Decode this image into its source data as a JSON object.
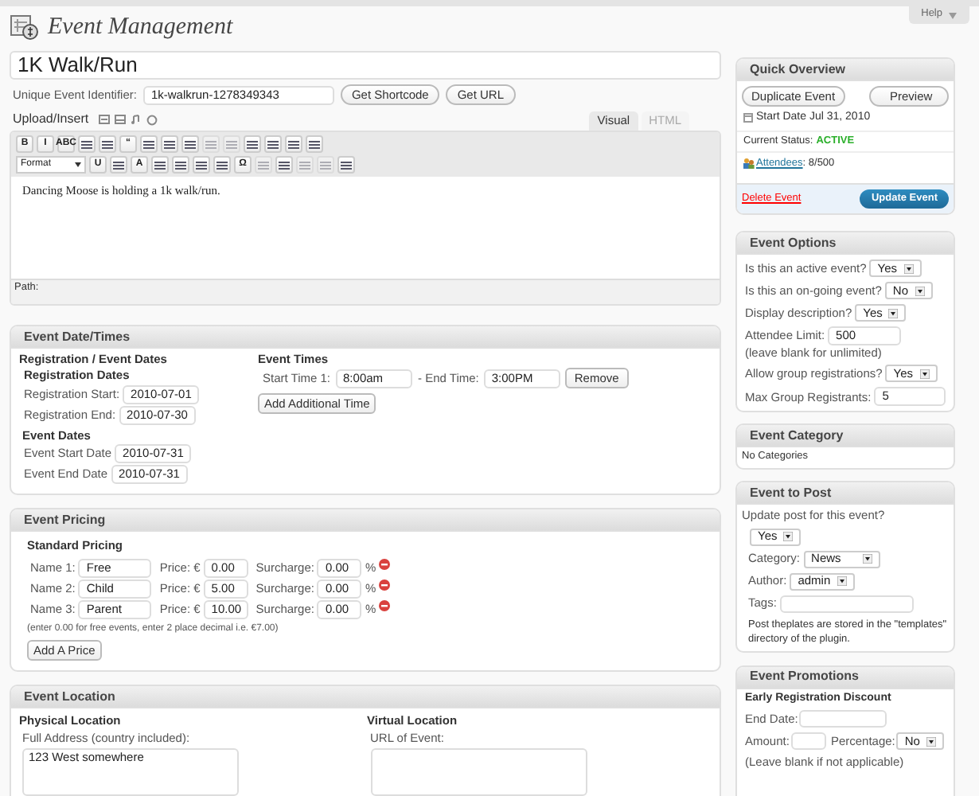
{
  "header": {
    "title": "Event Management",
    "help": "Help"
  },
  "event": {
    "title": "1K Walk/Run",
    "identifier_label": "Unique Event Identifier:",
    "identifier": "1k-walkrun-1278349343",
    "buttons": [
      "Get Shortcode",
      "Get URL"
    ],
    "upload_label": "Upload/Insert",
    "editor_tabs": [
      {
        "label": "Visual",
        "selected": true
      },
      {
        "label": "HTML",
        "selected": false
      }
    ],
    "toolbar": [
      [
        {
          "kind": "glyph",
          "label": "B"
        },
        {
          "kind": "glyph",
          "label": "I"
        },
        {
          "kind": "glyph",
          "label": "ABC"
        },
        {
          "kind": "icon",
          "disabled": false
        },
        {
          "kind": "icon",
          "disabled": false
        },
        {
          "kind": "glyph",
          "label": "“"
        },
        {
          "kind": "icon",
          "disabled": false
        },
        {
          "kind": "icon",
          "disabled": false
        },
        {
          "kind": "icon",
          "disabled": false
        },
        {
          "kind": "icon",
          "disabled": true
        },
        {
          "kind": "icon",
          "disabled": true
        },
        {
          "kind": "icon",
          "disabled": false
        },
        {
          "kind": "icon",
          "disabled": false
        },
        {
          "kind": "icon",
          "disabled": false
        },
        {
          "kind": "icon",
          "disabled": false
        }
      ],
      [
        {
          "kind": "select",
          "label": "Format"
        },
        {
          "kind": "glyph",
          "label": "U"
        },
        {
          "kind": "icon",
          "disabled": false
        },
        {
          "kind": "glyph",
          "label": "A"
        },
        {
          "kind": "icon",
          "disabled": false
        },
        {
          "kind": "icon",
          "disabled": false
        },
        {
          "kind": "icon",
          "disabled": false
        },
        {
          "kind": "icon",
          "disabled": false
        },
        {
          "kind": "glyph",
          "label": "Ω"
        },
        {
          "kind": "icon",
          "disabled": true
        },
        {
          "kind": "icon",
          "disabled": false
        },
        {
          "kind": "icon",
          "disabled": true
        },
        {
          "kind": "icon",
          "disabled": true
        },
        {
          "kind": "icon",
          "disabled": false
        }
      ]
    ],
    "content": "Dancing Moose is holding a 1k walk/run.",
    "path_label": "Path:"
  },
  "date_times": {
    "title": "Event Date/Times",
    "section": "Registration / Event Dates",
    "groups": [
      {
        "heading": "Registration Dates",
        "fields": [
          {
            "label": "Registration Start:",
            "value": "2010-07-01"
          },
          {
            "label": "Registration End:",
            "value": "2010-07-30"
          }
        ]
      },
      {
        "heading": "Event Dates",
        "fields": [
          {
            "label": "Event Start Date",
            "value": "2010-07-31"
          },
          {
            "label": "Event End Date",
            "value": "2010-07-31"
          }
        ]
      }
    ],
    "times_heading": "Event Times",
    "start_label": "Start Time 1:",
    "start": "8:00am",
    "end_label": "- End Time:",
    "end": "3:00PM",
    "remove": "Remove",
    "add": "Add Additional Time"
  },
  "pricing": {
    "title": "Event Pricing",
    "heading": "Standard Pricing",
    "rows": [
      {
        "name_label": "Name 1:",
        "name": "Free",
        "price_label": "Price: €",
        "price": "0.00",
        "surcharge_label": "Surcharge:",
        "surcharge": "0.00",
        "unit": "%"
      },
      {
        "name_label": "Name 2:",
        "name": "Child",
        "price_label": "Price: €",
        "price": "5.00",
        "surcharge_label": "Surcharge:",
        "surcharge": "0.00",
        "unit": "%"
      },
      {
        "name_label": "Name 3:",
        "name": "Parent",
        "price_label": "Price: €",
        "price": "10.00",
        "surcharge_label": "Surcharge:",
        "surcharge": "0.00",
        "unit": "%"
      }
    ],
    "note": "(enter 0.00 for free events, enter 2 place decimal i.e. €7.00)",
    "add": "Add A Price"
  },
  "location": {
    "title": "Event Location",
    "physical_heading": "Physical Location",
    "address_label": "Full Address (country included):",
    "address": "123 West somewhere",
    "virtual_heading": "Virtual Location",
    "url_label": "URL of Event:"
  },
  "quick": {
    "title": "Quick Overview",
    "duplicate": "Duplicate Event",
    "preview": "Preview",
    "start_date": "Start Date Jul 31, 2010",
    "status_label": "Current Status:",
    "status": "ACTIVE",
    "attendees_link": "Attendees",
    "attendees_count": ": 8/500",
    "delete": "Delete Event",
    "update": "Update Event"
  },
  "options": {
    "title": "Event Options",
    "rows": [
      {
        "kind": "select",
        "label": "Is this an active event?",
        "value": "Yes"
      },
      {
        "kind": "select",
        "label": "Is this an on-going event?",
        "value": "No"
      },
      {
        "kind": "select",
        "label": "Display description?",
        "value": "Yes"
      },
      {
        "kind": "input",
        "label": "Attendee Limit:",
        "value": "500",
        "note": "(leave blank for unlimited)"
      },
      {
        "kind": "select",
        "label": "Allow group registrations?",
        "value": "Yes"
      },
      {
        "kind": "input",
        "label": "Max Group Registrants:",
        "value": "5"
      }
    ]
  },
  "category": {
    "title": "Event Category",
    "text": "No Categories"
  },
  "post": {
    "title": "Event to Post",
    "question": "Update post for this event?",
    "answer": "Yes",
    "category_label": "Category:",
    "category": "News",
    "author_label": "Author:",
    "author": "admin",
    "tags_label": "Tags:",
    "note": "Post theplates are stored in the \"templates\" directory of the plugin."
  },
  "promotions": {
    "title": "Event Promotions",
    "heading": "Early Registration Discount",
    "end_label": "End Date:",
    "amount_label": "Amount:",
    "percentage_label": "Percentage:",
    "percentage": "No",
    "note": "(Leave blank if not applicable)"
  }
}
